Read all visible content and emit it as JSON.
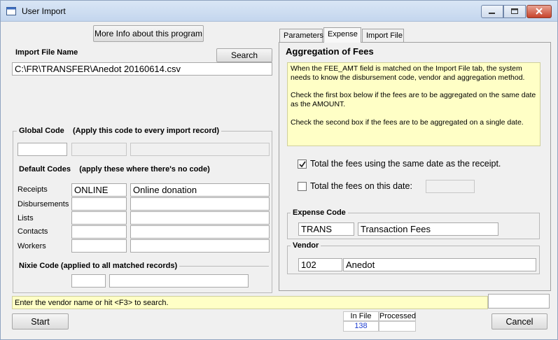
{
  "window": {
    "title": "User Import"
  },
  "left": {
    "more_info_label": "More Info about this program",
    "import_file_label": "Import File Name",
    "search_label": "Search",
    "import_file_value": "C:\\FR\\TRANSFER\\Anedot 20160614.csv",
    "global_code_title": "Global Code",
    "global_code_hint": "(Apply this code to every import record)",
    "default_codes_title": "Default Codes",
    "default_codes_hint": "(apply these where there's no code)",
    "rows": [
      {
        "label": "Receipts",
        "code": "ONLINE",
        "desc": "Online donation"
      },
      {
        "label": "Disbursements",
        "code": "",
        "desc": ""
      },
      {
        "label": "Lists",
        "code": "",
        "desc": ""
      },
      {
        "label": "Contacts",
        "code": "",
        "desc": ""
      },
      {
        "label": "Workers",
        "code": "",
        "desc": ""
      }
    ],
    "nixie_title": "Nixie Code (applied to all matched records)"
  },
  "tabs": [
    {
      "label": "Parameters"
    },
    {
      "label": "Expense"
    },
    {
      "label": "Import File"
    }
  ],
  "expense": {
    "heading": "Aggregation of Fees",
    "info_p1": "When the FEE_AMT field is matched on the Import File tab, the system needs to know the disbursement code, vendor and aggregation method.",
    "info_p2": "Check the first box below if the fees are to be aggregated on the same date as the AMOUNT.",
    "info_p3": "Check the second box if the fees are to be aggregated on a single date.",
    "check1_label": "Total the fees using the same date as the receipt.",
    "check1_checked": true,
    "check2_label": "Total the fees on this date:",
    "check2_checked": false,
    "expense_code_title": "Expense Code",
    "expense_code": "TRANS",
    "expense_desc": "Transaction Fees",
    "vendor_title": "Vendor",
    "vendor_code": "102",
    "vendor_name": "Anedot"
  },
  "footer": {
    "status_text": "Enter the vendor name or hit <F3> to search.",
    "start_label": "Start",
    "cancel_label": "Cancel",
    "in_file_label": "In File",
    "processed_label": "Processed",
    "in_file_value": "138",
    "processed_value": ""
  }
}
